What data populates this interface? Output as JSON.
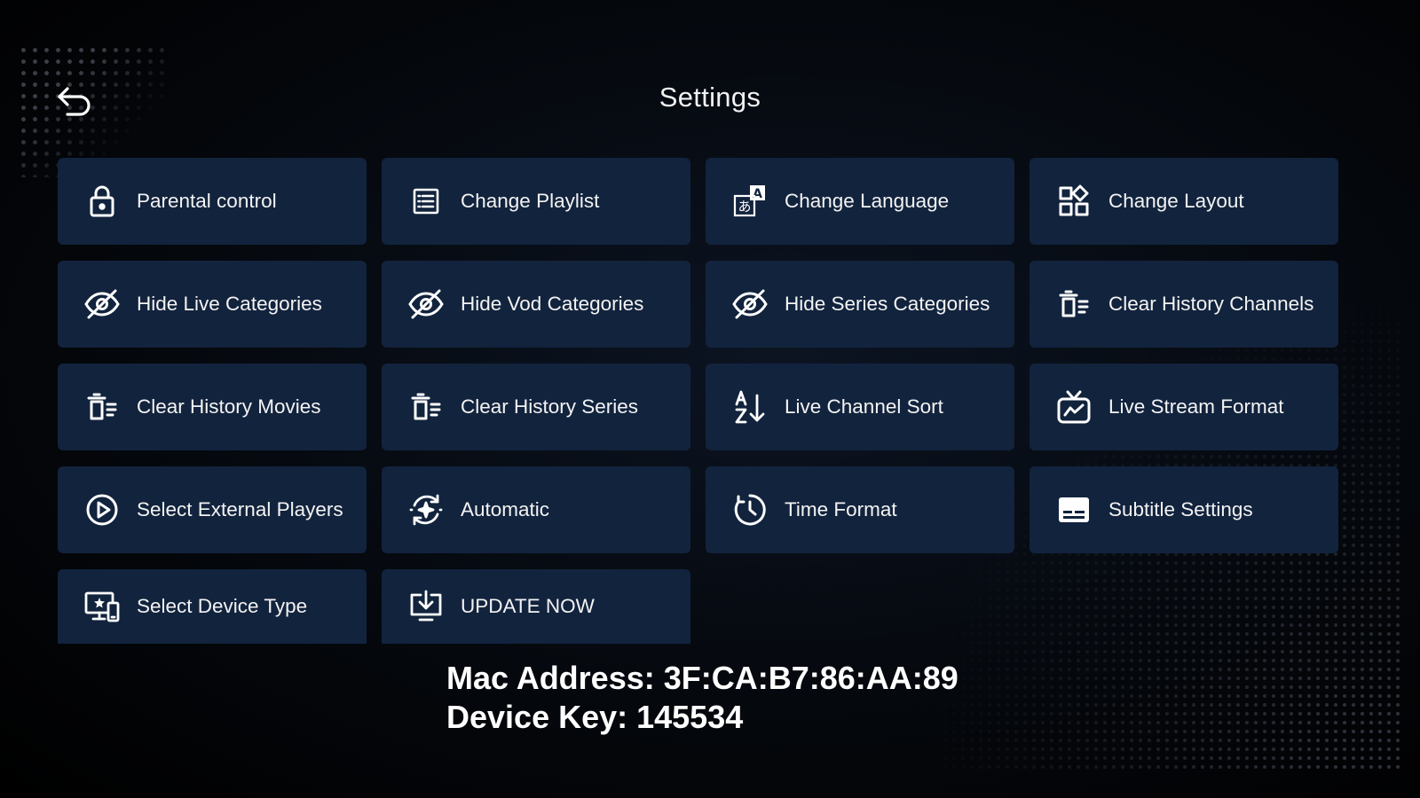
{
  "header": {
    "title": "Settings",
    "back_icon": "back-arrow-icon"
  },
  "settings": [
    {
      "label": "Parental control",
      "icon": "lock-icon"
    },
    {
      "label": "Change Playlist",
      "icon": "list-icon"
    },
    {
      "label": "Change Language",
      "icon": "translate-icon"
    },
    {
      "label": "Change Layout",
      "icon": "layout-icon"
    },
    {
      "label": "Hide Live Categories",
      "icon": "eye-off-icon"
    },
    {
      "label": "Hide Vod Categories",
      "icon": "eye-off-icon"
    },
    {
      "label": "Hide Series Categories",
      "icon": "eye-off-icon"
    },
    {
      "label": "Clear History Channels",
      "icon": "clear-history-icon"
    },
    {
      "label": "Clear History Movies",
      "icon": "clear-history-icon"
    },
    {
      "label": "Clear History Series",
      "icon": "clear-history-icon"
    },
    {
      "label": "Live Channel Sort",
      "icon": "sort-az-icon"
    },
    {
      "label": "Live Stream Format",
      "icon": "tv-icon"
    },
    {
      "label": "Select External Players",
      "icon": "play-circle-icon"
    },
    {
      "label": "Automatic",
      "icon": "auto-refresh-icon"
    },
    {
      "label": "Time Format",
      "icon": "clock-icon"
    },
    {
      "label": "Subtitle Settings",
      "icon": "subtitles-icon"
    },
    {
      "label": "Select Device Type",
      "icon": "devices-icon"
    },
    {
      "label": "UPDATE NOW",
      "icon": "download-icon"
    }
  ],
  "device": {
    "mac_line": "Mac Address: 3F:CA:B7:86:AA:89",
    "key_line": "Device Key: 145534"
  },
  "colors": {
    "background": "#000000",
    "tile": "#12233d",
    "text": "#f3f3f3"
  }
}
